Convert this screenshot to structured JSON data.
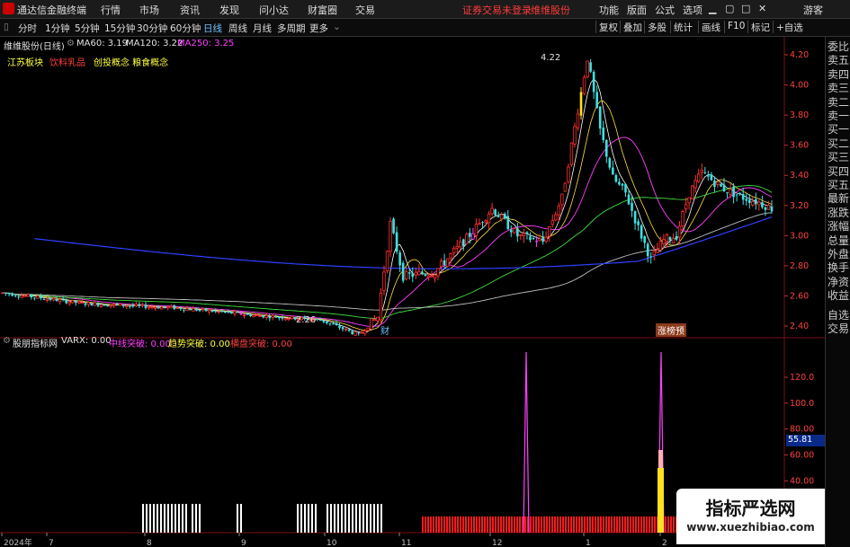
{
  "app": {
    "title": "通达信金融终端"
  },
  "menu": [
    "行情",
    "市场",
    "资讯",
    "发现",
    "问小达",
    "财富圈",
    "交易"
  ],
  "status": {
    "account": "证券交易未登录",
    "stock_link": "维维股份"
  },
  "right_menu": [
    "功能",
    "版面",
    "公式",
    "选项"
  ],
  "guest": "游客",
  "toolbar": {
    "periods": [
      "分时",
      "1分钟",
      "5分钟",
      "15分钟",
      "30分钟",
      "60分钟",
      "日线",
      "周线",
      "月线",
      "多周期",
      "更多"
    ],
    "selected": "日线",
    "buttons": [
      "复权",
      "叠加",
      "多股",
      "统计",
      "画线",
      "F10",
      "标记",
      "+自选"
    ]
  },
  "sidepanel": [
    "委比",
    "卖五",
    "卖四",
    "卖三",
    "卖二",
    "卖一",
    "买一",
    "买二",
    "买三",
    "买四",
    "买五",
    "最新",
    "涨跌",
    "涨幅",
    "总量",
    "外盘",
    "换手",
    "净资",
    "收益",
    "自选",
    "交易"
  ],
  "main_chart": {
    "stock": "维维股份(日线)",
    "ma": [
      {
        "label": "MA60: 3.19",
        "color": "#e0e0e0"
      },
      {
        "label": "MA120: 3.22",
        "color": "#e0e0e0"
      },
      {
        "label": "MA250: 3.25",
        "color": "#ff40ff"
      }
    ],
    "tags": [
      {
        "text": "江苏板块",
        "color": "#ffff40"
      },
      {
        "text": "饮料乳品",
        "color": "#ff4040"
      },
      {
        "text": "创投概念 粮食概念",
        "color": "#ffff40"
      }
    ],
    "high_label": "4.22",
    "low_label": "2.26",
    "event_tag": "财",
    "event_tag2": "涨榜预"
  },
  "indicator": {
    "name": "股朋指标网",
    "items": [
      {
        "label": "VARX: 0.00",
        "color": "#e0e0e0"
      },
      {
        "label": "中线突破: 0.00",
        "color": "#ff40ff"
      },
      {
        "label": "趋势突破: 0.00",
        "color": "#ffff40"
      },
      {
        "label": "横盘突破: 0.00",
        "color": "#ff4040"
      }
    ],
    "current_value": "55.81"
  },
  "chart_data": {
    "type": "candlestick",
    "y_ticks": [
      "4.20",
      "4.00",
      "3.80",
      "3.60",
      "3.40",
      "3.20",
      "3.00",
      "2.80",
      "2.60",
      "2.40"
    ],
    "ind_ticks": [
      "120.0",
      "100.0",
      "80.00",
      "60.00",
      "40.00"
    ],
    "x_labels": [
      "2024年",
      "7",
      "8",
      "9",
      "10",
      "11",
      "12",
      "1",
      "2"
    ]
  },
  "watermark": {
    "line1": "指标严选网",
    "line2": "www.xuezhibiao.com"
  }
}
